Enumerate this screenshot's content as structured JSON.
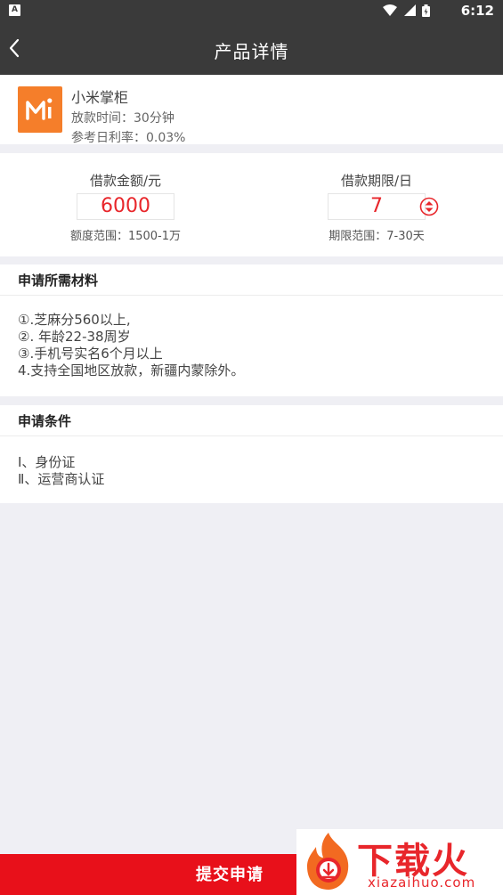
{
  "status_bar": {
    "time": "6:12",
    "notification_glyph": "A",
    "icons": [
      "wifi-icon",
      "cell-signal-icon",
      "battery-charging-icon"
    ]
  },
  "app_bar": {
    "title": "产品详情",
    "back_icon": "chevron-left-icon"
  },
  "product": {
    "name": "小米掌柜",
    "lines": [
      "放款时间：30分钟",
      "参考日利率：0.03%"
    ],
    "logo_color": "#f57e2a"
  },
  "loan": {
    "amount_label": "借款金额/元",
    "amount_value": "6000",
    "amount_range": "额度范围：1500-1万",
    "term_label": "借款期限/日",
    "term_value": "7",
    "term_range": "期限范围：7-30天",
    "stepper_icon": "up-down-circle-icon"
  },
  "materials": {
    "title": "申请所需材料",
    "items": [
      "①.芝麻分560以上,",
      "②. 年龄22-38周岁",
      "③.手机号实名6个月以上",
      "4.支持全国地区放款，新疆内蒙除外。"
    ]
  },
  "conditions": {
    "title": "申请条件",
    "items": [
      "Ⅰ、身份证",
      "Ⅱ、运营商认证"
    ]
  },
  "submit": {
    "label": "提交申请"
  },
  "watermark": {
    "text": "下载火",
    "url": "xiazaihuo.com"
  },
  "colors": {
    "app_bar": "#3a3a3a",
    "accent_red": "#e8262b",
    "submit_bar": "#e8101a",
    "background": "#efeff4"
  }
}
